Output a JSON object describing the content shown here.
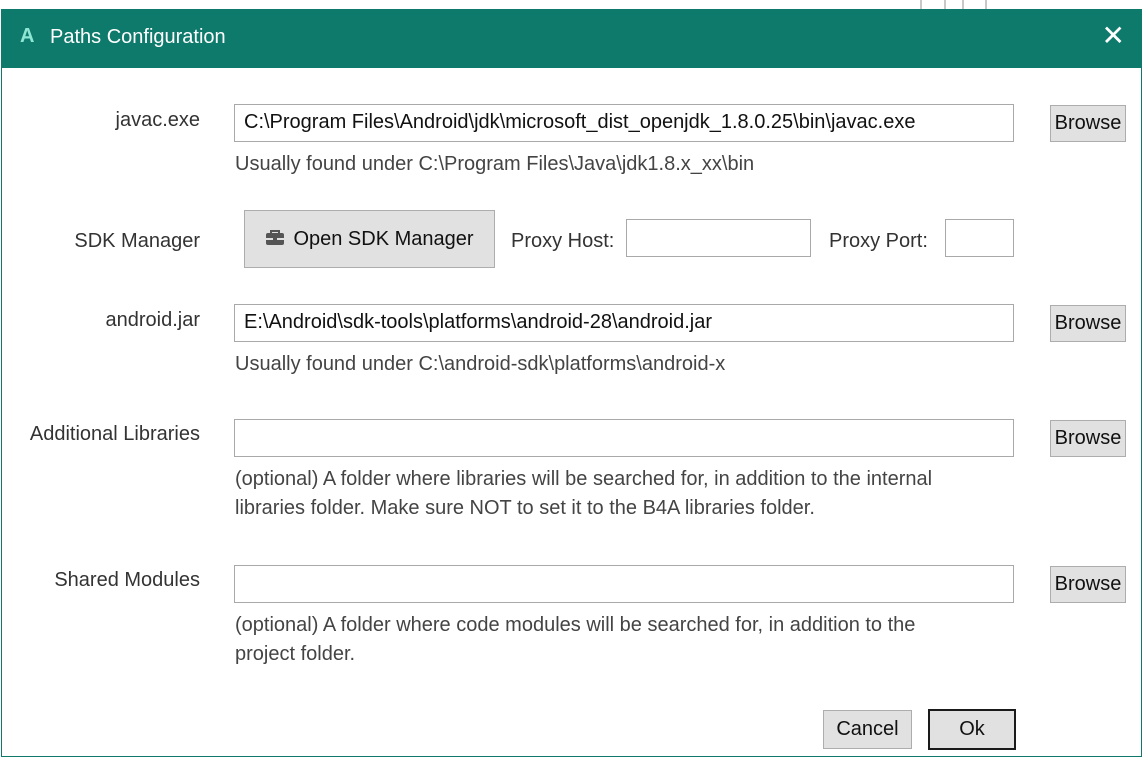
{
  "window": {
    "title": "Paths Configuration",
    "icon": "b4a-logo-icon",
    "close_glyph": "✕"
  },
  "javac": {
    "label": "javac.exe",
    "value": "C:\\Program Files\\Android\\jdk\\microsoft_dist_openjdk_1.8.0.25\\bin\\javac.exe",
    "browse": "Browse",
    "hint": "Usually found under C:\\Program Files\\Java\\jdk1.8.x_xx\\bin"
  },
  "sdk": {
    "label": "SDK Manager",
    "button": "Open SDK Manager",
    "proxy_host_label": "Proxy Host:",
    "proxy_host_value": "",
    "proxy_port_label": "Proxy Port:",
    "proxy_port_value": ""
  },
  "android_jar": {
    "label": "android.jar",
    "value": "E:\\Android\\sdk-tools\\platforms\\android-28\\android.jar",
    "browse": "Browse",
    "hint": "Usually found under C:\\android-sdk\\platforms\\android-x"
  },
  "additional_libraries": {
    "label": "Additional Libraries",
    "value": "",
    "browse": "Browse",
    "hint_line1": "(optional) A folder where libraries will be searched for, in addition to the internal",
    "hint_line2": "libraries folder. Make sure NOT to set it to the B4A libraries folder."
  },
  "shared_modules": {
    "label": "Shared Modules",
    "value": "",
    "browse": "Browse",
    "hint_line1": "(optional) A folder where code modules will be searched for, in addition to the",
    "hint_line2": "project folder."
  },
  "footer": {
    "cancel": "Cancel",
    "ok": "Ok"
  },
  "colors": {
    "titlebar": "#0e7a6c",
    "button": "#e1e1e1"
  }
}
